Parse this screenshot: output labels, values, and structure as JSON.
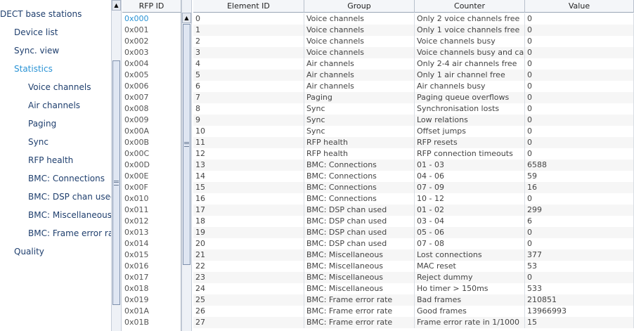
{
  "nav": {
    "root_label": "DECT base stations",
    "items": [
      {
        "label": "Device list",
        "level": 1
      },
      {
        "label": "Sync. view",
        "level": 1
      },
      {
        "label": "Statistics",
        "level": 1,
        "selected": true
      },
      {
        "label": "Voice channels",
        "level": 2
      },
      {
        "label": "Air channels",
        "level": 2
      },
      {
        "label": "Paging",
        "level": 2
      },
      {
        "label": "Sync",
        "level": 2
      },
      {
        "label": "RFP health",
        "level": 2
      },
      {
        "label": "BMC: Connections",
        "level": 2
      },
      {
        "label": "BMC: DSP chan used",
        "level": 2
      },
      {
        "label": "BMC: Miscellaneous",
        "level": 2
      },
      {
        "label": "BMC: Frame error rate",
        "level": 2
      },
      {
        "label": "Quality",
        "level": 1
      }
    ]
  },
  "rfp_list": {
    "header": "RFP ID",
    "items": [
      "0x000",
      "0x001",
      "0x002",
      "0x003",
      "0x004",
      "0x005",
      "0x006",
      "0x007",
      "0x008",
      "0x009",
      "0x00A",
      "0x00B",
      "0x00C",
      "0x00D",
      "0x00E",
      "0x00F",
      "0x010",
      "0x011",
      "0x012",
      "0x013",
      "0x014",
      "0x015",
      "0x016",
      "0x017",
      "0x018",
      "0x019",
      "0x01A",
      "0x01B"
    ],
    "selected_index": 0
  },
  "table": {
    "columns": [
      "Element ID",
      "Group",
      "Counter",
      "Value"
    ],
    "rows": [
      [
        "0",
        "Voice channels",
        "Only 2 voice channels free",
        "0"
      ],
      [
        "1",
        "Voice channels",
        "Only 1 voice channels free",
        "0"
      ],
      [
        "2",
        "Voice channels",
        "Voice channels busy",
        "0"
      ],
      [
        "3",
        "Voice channels",
        "Voice channels busy and call...",
        "0"
      ],
      [
        "4",
        "Air channels",
        "Only 2-4 air channels free",
        "0"
      ],
      [
        "5",
        "Air channels",
        "Only 1 air channel free",
        "0"
      ],
      [
        "6",
        "Air channels",
        "Air channels busy",
        "0"
      ],
      [
        "7",
        "Paging",
        "Paging queue overflows",
        "0"
      ],
      [
        "8",
        "Sync",
        "Synchronisation losts",
        "0"
      ],
      [
        "9",
        "Sync",
        "Low relations",
        "0"
      ],
      [
        "10",
        "Sync",
        "Offset jumps",
        "0"
      ],
      [
        "11",
        "RFP health",
        "RFP resets",
        "0"
      ],
      [
        "12",
        "RFP health",
        "RFP connection timeouts",
        "0"
      ],
      [
        "13",
        "BMC: Connections",
        "01 - 03",
        "6588"
      ],
      [
        "14",
        "BMC: Connections",
        "04 - 06",
        "59"
      ],
      [
        "15",
        "BMC: Connections",
        "07 - 09",
        "16"
      ],
      [
        "16",
        "BMC: Connections",
        "10 - 12",
        "0"
      ],
      [
        "17",
        "BMC: DSP chan used",
        "01 - 02",
        "299"
      ],
      [
        "18",
        "BMC: DSP chan used",
        "03 - 04",
        "6"
      ],
      [
        "19",
        "BMC: DSP chan used",
        "05 - 06",
        "0"
      ],
      [
        "20",
        "BMC: DSP chan used",
        "07 - 08",
        "0"
      ],
      [
        "21",
        "BMC: Miscellaneous",
        "Lost connections",
        "377"
      ],
      [
        "22",
        "BMC: Miscellaneous",
        "MAC reset",
        "53"
      ],
      [
        "23",
        "BMC: Miscellaneous",
        "Reject dummy",
        "0"
      ],
      [
        "24",
        "BMC: Miscellaneous",
        "Ho timer > 150ms",
        "533"
      ],
      [
        "25",
        "BMC: Frame error rate",
        "Bad frames",
        "210851"
      ],
      [
        "26",
        "BMC: Frame error rate",
        "Good frames",
        "13966993"
      ],
      [
        "27",
        "BMC: Frame error rate",
        "Frame error rate in 1/1000",
        "15"
      ]
    ]
  },
  "icons": {
    "scroll_up": "scroll-up-arrow-icon",
    "scroll_grip": "scrollbar-grip-icon"
  }
}
